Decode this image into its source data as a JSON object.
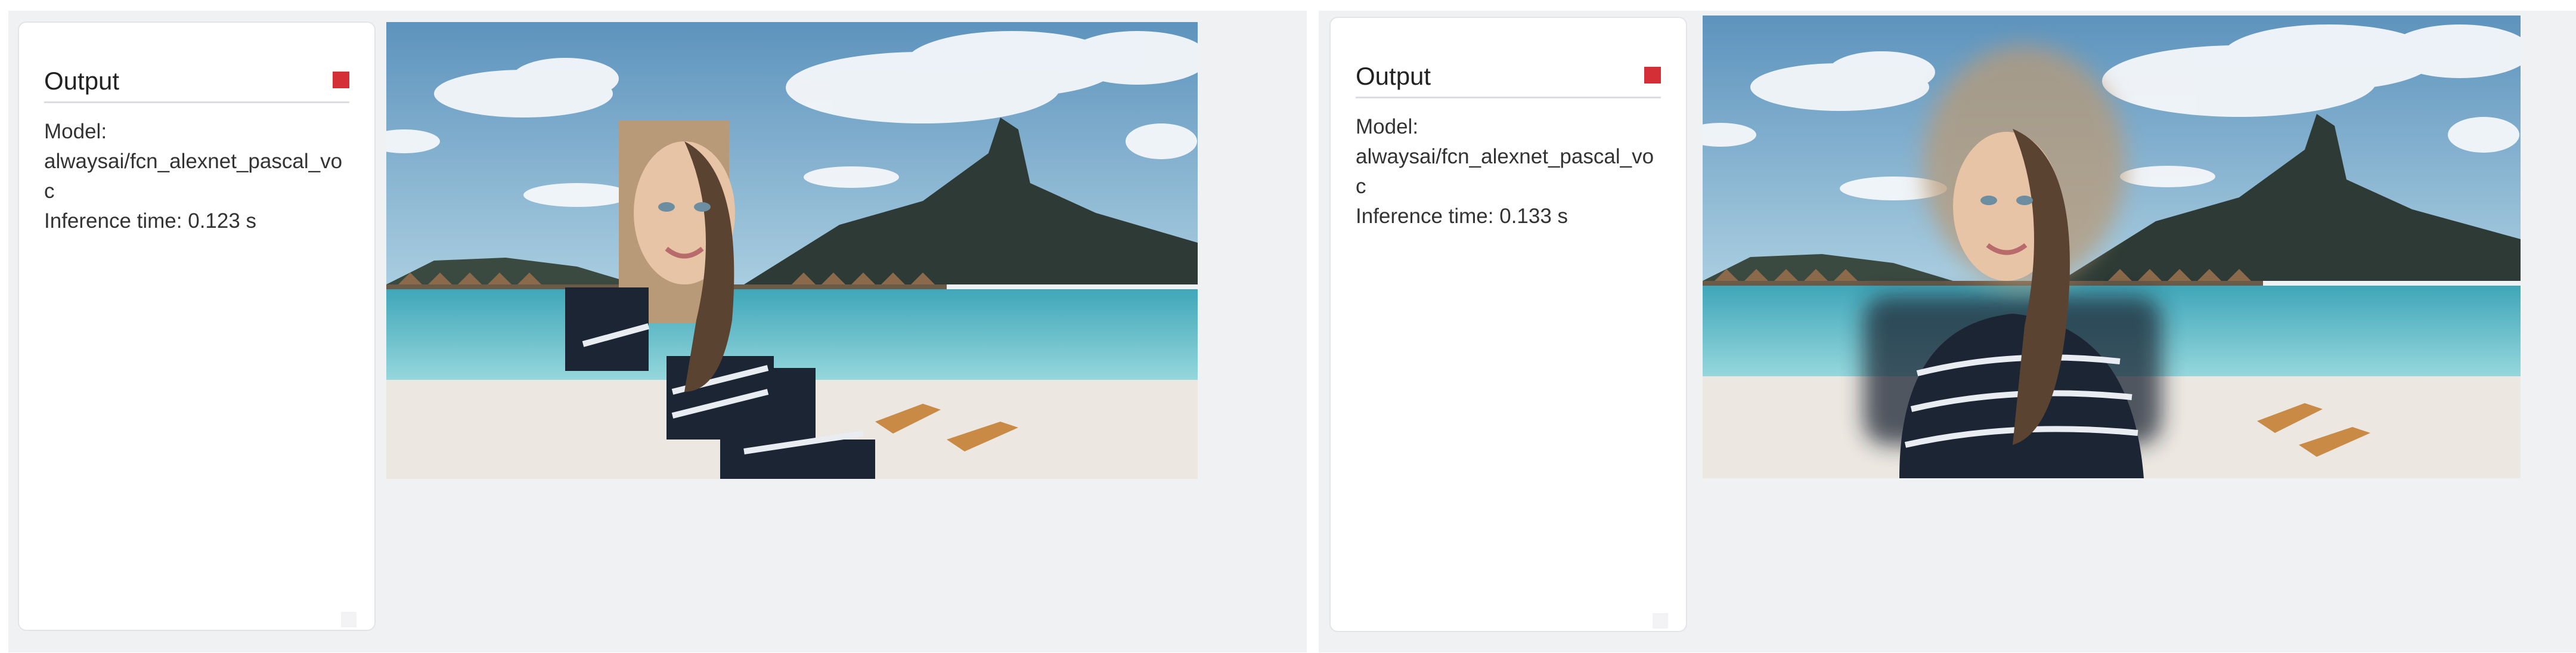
{
  "panels": [
    {
      "title": "Output",
      "model_label": "Model:",
      "model_value": "alwaysai/fcn_alexnet_pascal_voc",
      "inference_label": "Inference time: 0.123 s"
    },
    {
      "title": "Output",
      "model_label": "Model:",
      "model_value": "alwaysai/fcn_alexnet_pascal_voc",
      "inference_label": "Inference time: 0.133 s"
    }
  ],
  "colors": {
    "accent_stop": "#d42f36",
    "panel_bg": "#f0f1f3"
  },
  "icons": [
    "stop-icon",
    "resize-handle-icon"
  ]
}
